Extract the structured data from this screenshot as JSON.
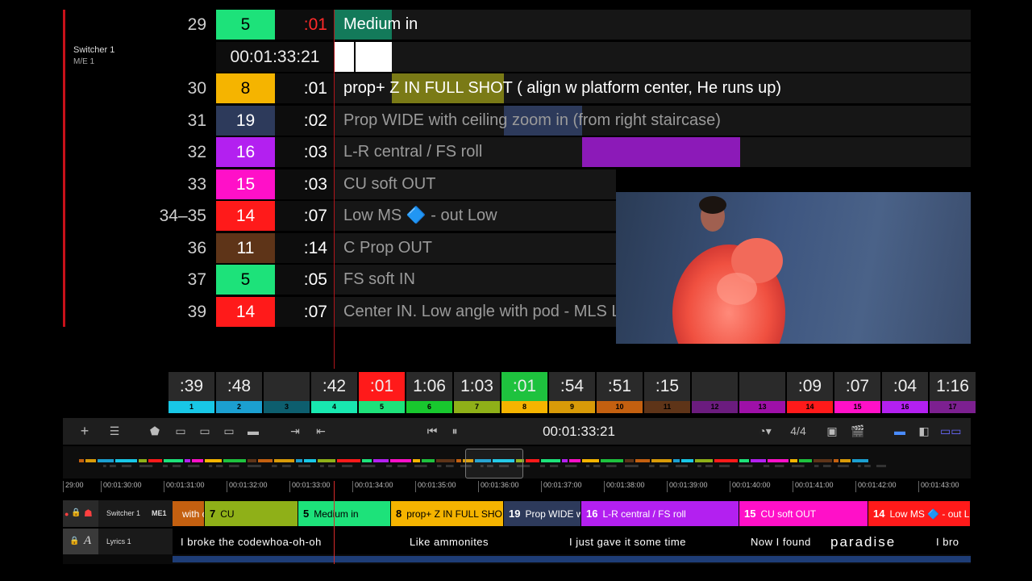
{
  "switcher": {
    "name": "Switcher 1",
    "me": "M/E 1"
  },
  "rows": [
    {
      "num": "29",
      "cam": "5",
      "cam_color": "#1de27a",
      "cam_text": "#000000",
      "dur": ":01",
      "dur_color": "#ff2a2a",
      "desc": "Medium in",
      "desc_color": "#ffffff"
    },
    {
      "num": "30",
      "cam": "8",
      "cam_color": "#f5b400",
      "cam_text": "#000000",
      "dur": ":01",
      "dur_color": "#ffffff",
      "desc": "prop+ Z IN FULL SHOT ( align w platform center, He runs up)",
      "desc_color": "#ffffff"
    },
    {
      "num": "31",
      "cam": "19",
      "cam_color": "#2d3a5b",
      "cam_text": "#ffffff",
      "dur": ":02",
      "dur_color": "#ffffff",
      "desc": "Prop WIDE with ceiling zoom in (from right staircase)",
      "desc_color": "#9a9a9a"
    },
    {
      "num": "32",
      "cam": "16",
      "cam_color": "#b320f0",
      "cam_text": "#ffffff",
      "dur": ":03",
      "dur_color": "#ffffff",
      "desc": "L-R central / FS roll",
      "desc_color": "#9a9a9a"
    },
    {
      "num": "33",
      "cam": "15",
      "cam_color": "#ff10c8",
      "cam_text": "#ffffff",
      "dur": ":03",
      "dur_color": "#ffffff",
      "desc": "CU soft OUT",
      "desc_color": "#9a9a9a"
    },
    {
      "num": "34–35",
      "cam": "14",
      "cam_color": "#ff1a1a",
      "cam_text": "#ffffff",
      "dur": ":07",
      "dur_color": "#ffffff",
      "desc": "Low MS 🔷 - out Low",
      "desc_color": "#9a9a9a"
    },
    {
      "num": "36",
      "cam": "11",
      "cam_color": "#5e3418",
      "cam_text": "#ffffff",
      "dur": ":14",
      "dur_color": "#ffffff",
      "desc": "C Prop OUT",
      "desc_color": "#9a9a9a"
    },
    {
      "num": "37",
      "cam": "5",
      "cam_color": "#1de27a",
      "cam_text": "#000000",
      "dur": ":05",
      "dur_color": "#ffffff",
      "desc": "FS soft IN",
      "desc_color": "#9a9a9a"
    },
    {
      "num": "39",
      "cam": "14",
      "cam_color": "#ff1a1a",
      "cam_text": "#ffffff",
      "dur": ":07",
      "dur_color": "#ffffff",
      "desc": "Center IN. Low angle with pod - MLS L",
      "desc_color": "#9a9a9a"
    }
  ],
  "timecode_row": "00:01:33:21",
  "camera_strip": [
    {
      "time": ":39",
      "cam": "1",
      "color": "#18c7e6",
      "active": false
    },
    {
      "time": ":48",
      "cam": "2",
      "color": "#1b9fd0",
      "active": false
    },
    {
      "time": "",
      "cam": "3",
      "color": "#0d5e6e",
      "active": false
    },
    {
      "time": ":42",
      "cam": "4",
      "color": "#18e8b0",
      "active": false
    },
    {
      "time": ":01",
      "cam": "5",
      "color": "#1de27a",
      "active": "red"
    },
    {
      "time": "1:06",
      "cam": "6",
      "color": "#18c82e",
      "active": false
    },
    {
      "time": "1:03",
      "cam": "7",
      "color": "#8fb018",
      "active": false
    },
    {
      "time": ":01",
      "cam": "8",
      "color": "#f5b400",
      "active": "green"
    },
    {
      "time": ":54",
      "cam": "9",
      "color": "#d89a08",
      "active": false
    },
    {
      "time": ":51",
      "cam": "10",
      "color": "#c46010",
      "active": false
    },
    {
      "time": ":15",
      "cam": "11",
      "color": "#5e3418",
      "active": false
    },
    {
      "time": "",
      "cam": "12",
      "color": "#6b1c7e",
      "active": false
    },
    {
      "time": "",
      "cam": "13",
      "color": "#9e10a8",
      "active": false
    },
    {
      "time": ":09",
      "cam": "14",
      "color": "#ff1a1a",
      "active": false
    },
    {
      "time": ":07",
      "cam": "15",
      "color": "#ff10c8",
      "active": false
    },
    {
      "time": ":04",
      "cam": "16",
      "color": "#b320f0",
      "active": false
    },
    {
      "time": "1:16",
      "cam": "17",
      "color": "#7c2090",
      "active": false
    }
  ],
  "toolbar": {
    "timecode": "00:01:33:21",
    "meter": "4/4"
  },
  "ruler": [
    "29:00",
    "00:01:30:00",
    "00:01:31:00",
    "00:01:32:00",
    "00:01:33:00",
    "00:01:34:00",
    "00:01:35:00",
    "00:01:36:00",
    "00:01:37:00",
    "00:01:38:00",
    "00:01:39:00",
    "00:01:40:00",
    "00:01:41:00",
    "00:01:42:00",
    "00:01:43:00"
  ],
  "tracks": {
    "switcher": {
      "label": "Switcher 1",
      "badge": "ME1"
    },
    "lyrics": {
      "label": "Lyrics 1"
    }
  },
  "clips": [
    {
      "num": "",
      "text": "with ce",
      "color": "#c46010"
    },
    {
      "num": "7",
      "text": "CU",
      "color": "#8fb018"
    },
    {
      "num": "5",
      "text": "Medium in",
      "color": "#1de27a"
    },
    {
      "num": "8",
      "text": "prop+ Z IN FULL SHO",
      "color": "#f5b400"
    },
    {
      "num": "19",
      "text": "Prop WIDE w",
      "color": "#2d3a5b"
    },
    {
      "num": "16",
      "text": "L-R central / FS roll",
      "color": "#b320f0"
    },
    {
      "num": "15",
      "text": "CU soft OUT",
      "color": "#ff10c8"
    },
    {
      "num": "14",
      "text": "Low MS 🔷 - out L",
      "color": "#ff1a1a"
    }
  ],
  "lyrics": [
    "I broke the codewhoa-oh-oh",
    "Like ammonites",
    "I just gave it some time",
    "Now I found",
    "paradise",
    "I bro"
  ]
}
